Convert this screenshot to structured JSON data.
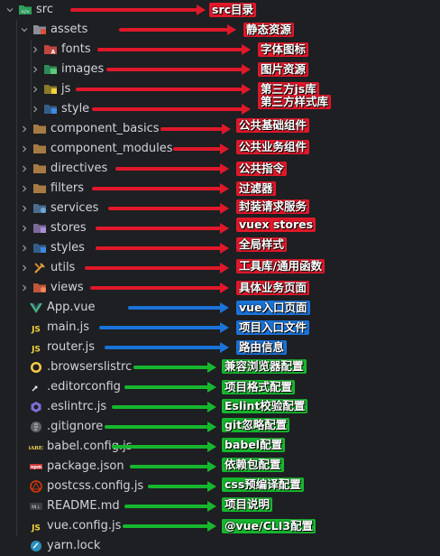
{
  "explorer": {
    "items": [
      {
        "label": "src",
        "icon": "folder-src-icon",
        "expanded": true
      },
      {
        "label": "assets",
        "icon": "folder-assets-icon",
        "expanded": true
      },
      {
        "label": "fonts",
        "icon": "folder-fonts-icon",
        "expanded": false
      },
      {
        "label": "images",
        "icon": "folder-images-icon",
        "expanded": false
      },
      {
        "label": "js",
        "icon": "folder-js-icon",
        "expanded": false
      },
      {
        "label": "style",
        "icon": "folder-style-icon",
        "expanded": false
      },
      {
        "label": "component_basics",
        "icon": "folder-icon",
        "expanded": false
      },
      {
        "label": "component_modules",
        "icon": "folder-icon",
        "expanded": false
      },
      {
        "label": "directives",
        "icon": "folder-icon",
        "expanded": false
      },
      {
        "label": "filters",
        "icon": "folder-icon",
        "expanded": false
      },
      {
        "label": "services",
        "icon": "folder-services-icon",
        "expanded": false
      },
      {
        "label": "stores",
        "icon": "folder-stores-icon",
        "expanded": false
      },
      {
        "label": "styles",
        "icon": "folder-styles-icon",
        "expanded": false
      },
      {
        "label": "utils",
        "icon": "folder-utils-icon",
        "expanded": false
      },
      {
        "label": "views",
        "icon": "folder-views-icon",
        "expanded": false
      },
      {
        "label": "App.vue",
        "icon": "vue-file-icon"
      },
      {
        "label": "main.js",
        "icon": "js-file-icon"
      },
      {
        "label": "router.js",
        "icon": "js-file-icon"
      },
      {
        "label": ".browserslistrc",
        "icon": "browserslist-file-icon"
      },
      {
        "label": ".editorconfig",
        "icon": "editorconfig-file-icon"
      },
      {
        "label": ".eslintrc.js",
        "icon": "eslint-file-icon"
      },
      {
        "label": ".gitignore",
        "icon": "git-file-icon"
      },
      {
        "label": "babel.config.js",
        "icon": "babel-file-icon"
      },
      {
        "label": "package.json",
        "icon": "npm-file-icon"
      },
      {
        "label": "postcss.config.js",
        "icon": "postcss-file-icon"
      },
      {
        "label": "README.md",
        "icon": "markdown-file-icon"
      },
      {
        "label": "vue.config.js",
        "icon": "js-file-icon"
      },
      {
        "label": "yarn.lock",
        "icon": "yarn-file-icon"
      }
    ]
  },
  "annotations": [
    {
      "text": "src目录",
      "color": "red"
    },
    {
      "text": "静态资源",
      "color": "red"
    },
    {
      "text": "字体图标",
      "color": "red"
    },
    {
      "text": "图片资源",
      "color": "red"
    },
    {
      "text": "第三方js库",
      "color": "red"
    },
    {
      "text": "第三方样式库",
      "color": "red"
    },
    {
      "text": "公共基础组件",
      "color": "red"
    },
    {
      "text": "公共业务组件",
      "color": "red"
    },
    {
      "text": "公共指令",
      "color": "red"
    },
    {
      "text": "过滤器",
      "color": "red"
    },
    {
      "text": "封装请求服务",
      "color": "red"
    },
    {
      "text": "vuex  stores",
      "color": "red"
    },
    {
      "text": "全局样式",
      "color": "red"
    },
    {
      "text": "工具库/通用函数",
      "color": "red"
    },
    {
      "text": "具体业务页面",
      "color": "red"
    },
    {
      "text": "vue入口页面",
      "color": "blue"
    },
    {
      "text": "项目入口文件",
      "color": "blue"
    },
    {
      "text": "路由信息",
      "color": "blue"
    },
    {
      "text": "兼容浏览器配置",
      "color": "green"
    },
    {
      "text": "项目格式配置",
      "color": "green"
    },
    {
      "text": "Eslint校验配置",
      "color": "green"
    },
    {
      "text": "git忽略配置",
      "color": "green"
    },
    {
      "text": "babel配置",
      "color": "green"
    },
    {
      "text": "依赖包配置",
      "color": "green"
    },
    {
      "text": "css预编译配置",
      "color": "green"
    },
    {
      "text": "项目说明",
      "color": "green"
    },
    {
      "text": "@vue/CLI3配置",
      "color": "green"
    }
  ],
  "colors": {
    "red": "#e0182a",
    "blue": "#1a73d9",
    "green": "#16b72e"
  }
}
